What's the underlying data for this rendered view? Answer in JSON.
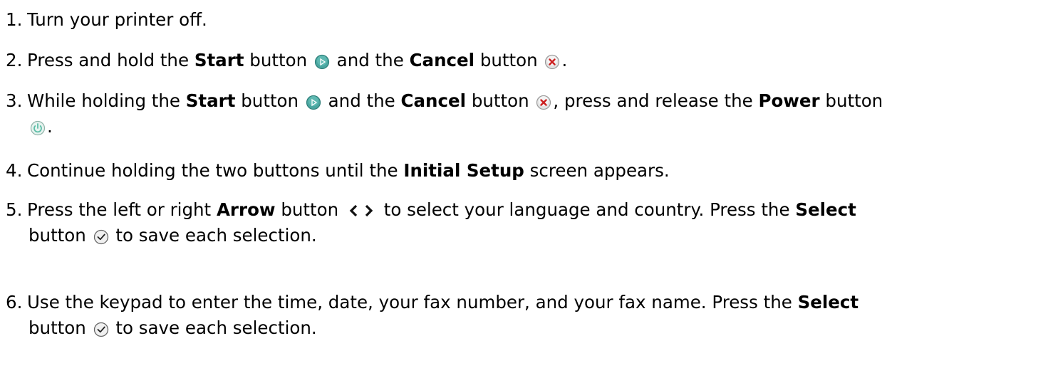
{
  "steps": [
    {
      "num": "1.",
      "parts": [
        "Turn your printer off."
      ]
    },
    {
      "num": "2.",
      "parts": [
        "Press and hold the ",
        "Start",
        " button ",
        " and the ",
        "Cancel",
        " button ",
        "."
      ]
    },
    {
      "num": "3.",
      "parts": [
        "While holding the ",
        "Start",
        " button ",
        " and the ",
        "Cancel",
        " button ",
        ", press and release the ",
        "Power",
        " button",
        "."
      ]
    },
    {
      "num": "4.",
      "parts": [
        "Continue holding the two buttons until the ",
        "Initial Setup",
        " screen appears."
      ]
    },
    {
      "num": "5.",
      "parts": [
        "Press the left or right ",
        "Arrow",
        " button ",
        " to select your language and country. Press the ",
        "Select",
        "button ",
        " to save each selection."
      ]
    },
    {
      "num": "6.",
      "parts": [
        "Use the keypad to enter the time, date, your fax number, and your fax name. Press the ",
        "Select",
        "button ",
        " to save each selection."
      ]
    }
  ],
  "icons": {
    "start": "start-button-icon",
    "cancel": "cancel-button-icon",
    "power": "power-button-icon",
    "arrows": "left-right-arrow-icon",
    "select": "select-checkmark-icon"
  },
  "colors": {
    "start": "#4aa6a0",
    "cancel_x": "#cc1f1f",
    "power": "#5fbfa8"
  }
}
